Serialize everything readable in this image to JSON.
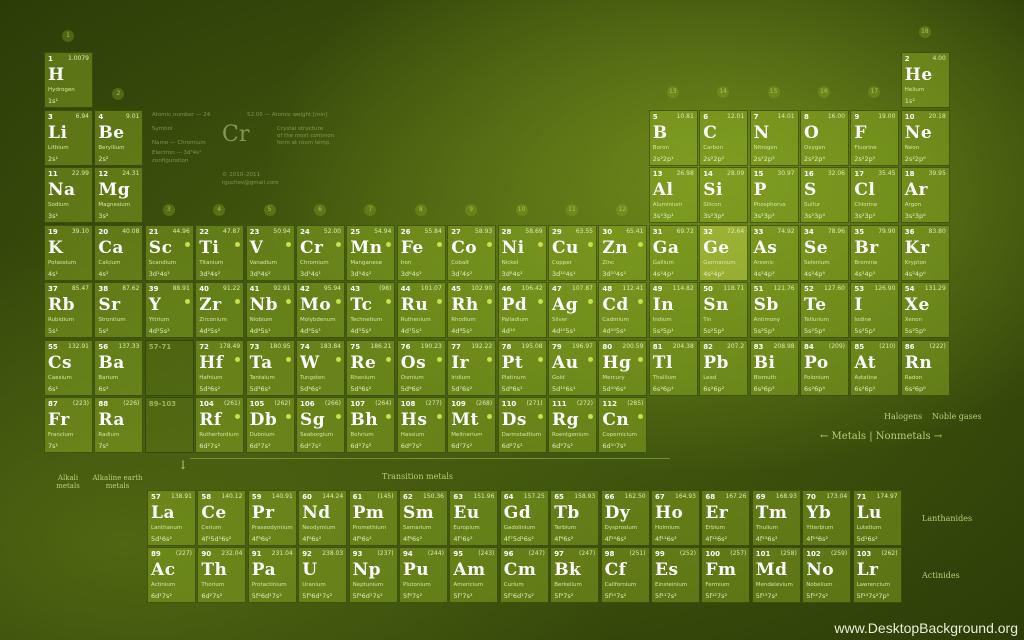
{
  "colors": {
    "accent": "#c8e04a",
    "background": "#3b4f0c"
  },
  "elements": [
    {
      "n": "1",
      "s": "H",
      "m": "1.0079",
      "nm": "Hydrogen",
      "c": "1s¹",
      "r": 1,
      "col": 1
    },
    {
      "n": "2",
      "s": "He",
      "m": "4.00",
      "nm": "Helium",
      "c": "1s²",
      "r": 1,
      "col": 18
    },
    {
      "n": "3",
      "s": "Li",
      "m": "6.94",
      "nm": "Lithium",
      "c": "2s¹",
      "r": 2,
      "col": 1
    },
    {
      "n": "4",
      "s": "Be",
      "m": "9.01",
      "nm": "Beryllium",
      "c": "2s²",
      "r": 2,
      "col": 2
    },
    {
      "n": "5",
      "s": "B",
      "m": "10.81",
      "nm": "Boron",
      "c": "2s²2p¹",
      "r": 2,
      "col": 13
    },
    {
      "n": "6",
      "s": "C",
      "m": "12.01",
      "nm": "Carbon",
      "c": "2s²2p²",
      "r": 2,
      "col": 14
    },
    {
      "n": "7",
      "s": "N",
      "m": "14.01",
      "nm": "Nitrogen",
      "c": "2s²2p³",
      "r": 2,
      "col": 15
    },
    {
      "n": "8",
      "s": "O",
      "m": "16.00",
      "nm": "Oxygen",
      "c": "2s²2p⁴",
      "r": 2,
      "col": 16
    },
    {
      "n": "9",
      "s": "F",
      "m": "19.00",
      "nm": "Fluorine",
      "c": "2s²2p⁵",
      "r": 2,
      "col": 17
    },
    {
      "n": "10",
      "s": "Ne",
      "m": "20.18",
      "nm": "Neon",
      "c": "2s²2p⁶",
      "r": 2,
      "col": 18
    },
    {
      "n": "11",
      "s": "Na",
      "m": "22.99",
      "nm": "Sodium",
      "c": "3s¹",
      "r": 3,
      "col": 1
    },
    {
      "n": "12",
      "s": "Mg",
      "m": "24.31",
      "nm": "Magnesium",
      "c": "3s²",
      "r": 3,
      "col": 2
    },
    {
      "n": "13",
      "s": "Al",
      "m": "26.98",
      "nm": "Aluminium",
      "c": "3s²3p¹",
      "r": 3,
      "col": 13
    },
    {
      "n": "14",
      "s": "Si",
      "m": "28.09",
      "nm": "Silicon",
      "c": "3s²3p²",
      "r": 3,
      "col": 14
    },
    {
      "n": "15",
      "s": "P",
      "m": "30.97",
      "nm": "Phosphorus",
      "c": "3s²3p³",
      "r": 3,
      "col": 15
    },
    {
      "n": "16",
      "s": "S",
      "m": "32.06",
      "nm": "Sulfur",
      "c": "3s²3p⁴",
      "r": 3,
      "col": 16
    },
    {
      "n": "17",
      "s": "Cl",
      "m": "35.45",
      "nm": "Chlorine",
      "c": "3s²3p⁵",
      "r": 3,
      "col": 17
    },
    {
      "n": "18",
      "s": "Ar",
      "m": "39.95",
      "nm": "Argon",
      "c": "3s²3p⁶",
      "r": 3,
      "col": 18
    },
    {
      "n": "19",
      "s": "K",
      "m": "39.10",
      "nm": "Potassium",
      "c": "4s¹",
      "r": 4,
      "col": 1
    },
    {
      "n": "20",
      "s": "Ca",
      "m": "40.08",
      "nm": "Calcium",
      "c": "4s²",
      "r": 4,
      "col": 2
    },
    {
      "n": "21",
      "s": "Sc",
      "m": "44.96",
      "nm": "Scandium",
      "c": "3d¹4s²",
      "r": 4,
      "col": 3
    },
    {
      "n": "22",
      "s": "Ti",
      "m": "47.87",
      "nm": "Titanium",
      "c": "3d²4s²",
      "r": 4,
      "col": 4
    },
    {
      "n": "23",
      "s": "V",
      "m": "50.94",
      "nm": "Vanadium",
      "c": "3d³4s²",
      "r": 4,
      "col": 5
    },
    {
      "n": "24",
      "s": "Cr",
      "m": "52.00",
      "nm": "Chromium",
      "c": "3d⁵4s¹",
      "r": 4,
      "col": 6
    },
    {
      "n": "25",
      "s": "Mn",
      "m": "54.94",
      "nm": "Manganese",
      "c": "3d⁵4s²",
      "r": 4,
      "col": 7
    },
    {
      "n": "26",
      "s": "Fe",
      "m": "55.84",
      "nm": "Iron",
      "c": "3d⁶4s²",
      "r": 4,
      "col": 8
    },
    {
      "n": "27",
      "s": "Co",
      "m": "58.93",
      "nm": "Cobalt",
      "c": "3d⁷4s²",
      "r": 4,
      "col": 9
    },
    {
      "n": "28",
      "s": "Ni",
      "m": "58.69",
      "nm": "Nickel",
      "c": "3d⁸4s²",
      "r": 4,
      "col": 10
    },
    {
      "n": "29",
      "s": "Cu",
      "m": "63.55",
      "nm": "Copper",
      "c": "3d¹⁰4s¹",
      "r": 4,
      "col": 11
    },
    {
      "n": "30",
      "s": "Zn",
      "m": "65.41",
      "nm": "Zinc",
      "c": "3d¹⁰4s²",
      "r": 4,
      "col": 12
    },
    {
      "n": "31",
      "s": "Ga",
      "m": "69.72",
      "nm": "Gallium",
      "c": "4s²4p¹",
      "r": 4,
      "col": 13
    },
    {
      "n": "32",
      "s": "Ge",
      "m": "72.64",
      "nm": "Germanium",
      "c": "4s²4p²",
      "r": 4,
      "col": 14,
      "hl": true
    },
    {
      "n": "33",
      "s": "As",
      "m": "74.92",
      "nm": "Arsenic",
      "c": "4s²4p³",
      "r": 4,
      "col": 15
    },
    {
      "n": "34",
      "s": "Se",
      "m": "78.96",
      "nm": "Selenium",
      "c": "4s²4p⁴",
      "r": 4,
      "col": 16
    },
    {
      "n": "35",
      "s": "Br",
      "m": "79.90",
      "nm": "Bromine",
      "c": "4s²4p⁵",
      "r": 4,
      "col": 17
    },
    {
      "n": "36",
      "s": "Kr",
      "m": "83.80",
      "nm": "Krypton",
      "c": "4s²4p⁶",
      "r": 4,
      "col": 18
    },
    {
      "n": "37",
      "s": "Rb",
      "m": "85.47",
      "nm": "Rubidium",
      "c": "5s¹",
      "r": 5,
      "col": 1
    },
    {
      "n": "38",
      "s": "Sr",
      "m": "87.62",
      "nm": "Strontium",
      "c": "5s²",
      "r": 5,
      "col": 2
    },
    {
      "n": "39",
      "s": "Y",
      "m": "88.91",
      "nm": "Yttrium",
      "c": "4d¹5s²",
      "r": 5,
      "col": 3
    },
    {
      "n": "40",
      "s": "Zr",
      "m": "91.22",
      "nm": "Zirconium",
      "c": "4d²5s²",
      "r": 5,
      "col": 4
    },
    {
      "n": "41",
      "s": "Nb",
      "m": "92.91",
      "nm": "Niobium",
      "c": "4d⁴5s¹",
      "r": 5,
      "col": 5
    },
    {
      "n": "42",
      "s": "Mo",
      "m": "95.94",
      "nm": "Molybdenum",
      "c": "4d⁵5s¹",
      "r": 5,
      "col": 6
    },
    {
      "n": "43",
      "s": "Tc",
      "m": "(98)",
      "nm": "Technetium",
      "c": "4d⁵5s²",
      "r": 5,
      "col": 7
    },
    {
      "n": "44",
      "s": "Ru",
      "m": "101.07",
      "nm": "Ruthenium",
      "c": "4d⁷5s¹",
      "r": 5,
      "col": 8
    },
    {
      "n": "45",
      "s": "Rh",
      "m": "102.90",
      "nm": "Rhodium",
      "c": "4d⁸5s¹",
      "r": 5,
      "col": 9
    },
    {
      "n": "46",
      "s": "Pd",
      "m": "106.42",
      "nm": "Palladium",
      "c": "4d¹⁰",
      "r": 5,
      "col": 10
    },
    {
      "n": "47",
      "s": "Ag",
      "m": "107.87",
      "nm": "Silver",
      "c": "4d¹⁰5s¹",
      "r": 5,
      "col": 11
    },
    {
      "n": "48",
      "s": "Cd",
      "m": "112.41",
      "nm": "Cadmium",
      "c": "4d¹⁰5s²",
      "r": 5,
      "col": 12
    },
    {
      "n": "49",
      "s": "In",
      "m": "114.82",
      "nm": "Indium",
      "c": "5s²5p¹",
      "r": 5,
      "col": 13
    },
    {
      "n": "50",
      "s": "Sn",
      "m": "118.71",
      "nm": "Tin",
      "c": "5s²5p²",
      "r": 5,
      "col": 14
    },
    {
      "n": "51",
      "s": "Sb",
      "m": "121.76",
      "nm": "Antimony",
      "c": "5s²5p³",
      "r": 5,
      "col": 15
    },
    {
      "n": "52",
      "s": "Te",
      "m": "127.60",
      "nm": "Tellurium",
      "c": "5s²5p⁴",
      "r": 5,
      "col": 16
    },
    {
      "n": "53",
      "s": "I",
      "m": "126.90",
      "nm": "Iodine",
      "c": "5s²5p⁵",
      "r": 5,
      "col": 17
    },
    {
      "n": "54",
      "s": "Xe",
      "m": "131.29",
      "nm": "Xenon",
      "c": "5s²5p⁶",
      "r": 5,
      "col": 18
    },
    {
      "n": "55",
      "s": "Cs",
      "m": "132.91",
      "nm": "Caesium",
      "c": "6s¹",
      "r": 6,
      "col": 1
    },
    {
      "n": "56",
      "s": "Ba",
      "m": "137.33",
      "nm": "Barium",
      "c": "6s²",
      "r": 6,
      "col": 2
    },
    {
      "n": "72",
      "s": "Hf",
      "m": "178.49",
      "nm": "Hafnium",
      "c": "5d²6s²",
      "r": 6,
      "col": 4
    },
    {
      "n": "73",
      "s": "Ta",
      "m": "180.95",
      "nm": "Tantalum",
      "c": "5d³6s²",
      "r": 6,
      "col": 5
    },
    {
      "n": "74",
      "s": "W",
      "m": "183.84",
      "nm": "Tungsten",
      "c": "5d⁴6s²",
      "r": 6,
      "col": 6
    },
    {
      "n": "75",
      "s": "Re",
      "m": "186.21",
      "nm": "Rhenium",
      "c": "5d⁵6s²",
      "r": 6,
      "col": 7
    },
    {
      "n": "76",
      "s": "Os",
      "m": "190.23",
      "nm": "Osmium",
      "c": "5d⁶6s²",
      "r": 6,
      "col": 8
    },
    {
      "n": "77",
      "s": "Ir",
      "m": "192.22",
      "nm": "Iridium",
      "c": "5d⁷6s²",
      "r": 6,
      "col": 9
    },
    {
      "n": "78",
      "s": "Pt",
      "m": "195.08",
      "nm": "Platinum",
      "c": "5d⁹6s¹",
      "r": 6,
      "col": 10
    },
    {
      "n": "79",
      "s": "Au",
      "m": "196.97",
      "nm": "Gold",
      "c": "5d¹⁰6s¹",
      "r": 6,
      "col": 11
    },
    {
      "n": "80",
      "s": "Hg",
      "m": "200.59",
      "nm": "Mercury",
      "c": "5d¹⁰6s²",
      "r": 6,
      "col": 12
    },
    {
      "n": "81",
      "s": "Tl",
      "m": "204.38",
      "nm": "Thallium",
      "c": "6s²6p¹",
      "r": 6,
      "col": 13
    },
    {
      "n": "82",
      "s": "Pb",
      "m": "207.2",
      "nm": "Lead",
      "c": "6s²6p²",
      "r": 6,
      "col": 14
    },
    {
      "n": "83",
      "s": "Bi",
      "m": "208.98",
      "nm": "Bismuth",
      "c": "6s²6p³",
      "r": 6,
      "col": 15
    },
    {
      "n": "84",
      "s": "Po",
      "m": "(209)",
      "nm": "Polonium",
      "c": "6s²6p⁴",
      "r": 6,
      "col": 16
    },
    {
      "n": "85",
      "s": "At",
      "m": "(210)",
      "nm": "Astatine",
      "c": "6s²6p⁵",
      "r": 6,
      "col": 17
    },
    {
      "n": "86",
      "s": "Rn",
      "m": "(222)",
      "nm": "Radon",
      "c": "6s²6p⁶",
      "r": 6,
      "col": 18
    },
    {
      "n": "87",
      "s": "Fr",
      "m": "(223)",
      "nm": "Francium",
      "c": "7s¹",
      "r": 7,
      "col": 1
    },
    {
      "n": "88",
      "s": "Ra",
      "m": "(226)",
      "nm": "Radium",
      "c": "7s²",
      "r": 7,
      "col": 2
    },
    {
      "n": "104",
      "s": "Rf",
      "m": "(261)",
      "nm": "Rutherfordium",
      "c": "6d²7s²",
      "r": 7,
      "col": 4
    },
    {
      "n": "105",
      "s": "Db",
      "m": "(262)",
      "nm": "Dubnium",
      "c": "6d³7s²",
      "r": 7,
      "col": 5
    },
    {
      "n": "106",
      "s": "Sg",
      "m": "(266)",
      "nm": "Seaborgium",
      "c": "6d⁴7s²",
      "r": 7,
      "col": 6
    },
    {
      "n": "107",
      "s": "Bh",
      "m": "(264)",
      "nm": "Bohrium",
      "c": "6d⁵7s²",
      "r": 7,
      "col": 7
    },
    {
      "n": "108",
      "s": "Hs",
      "m": "(277)",
      "nm": "Hassium",
      "c": "6d⁶7s²",
      "r": 7,
      "col": 8
    },
    {
      "n": "109",
      "s": "Mt",
      "m": "(268)",
      "nm": "Meitnerium",
      "c": "6d⁷7s²",
      "r": 7,
      "col": 9
    },
    {
      "n": "110",
      "s": "Ds",
      "m": "(271)",
      "nm": "Darmstadtium",
      "c": "6d⁸7s²",
      "r": 7,
      "col": 10
    },
    {
      "n": "111",
      "s": "Rg",
      "m": "(272)",
      "nm": "Roentgenium",
      "c": "6d⁹7s²",
      "r": 7,
      "col": 11
    },
    {
      "n": "112",
      "s": "Cn",
      "m": "(285)",
      "nm": "Copernicium",
      "c": "6d¹⁰7s²",
      "r": 7,
      "col": 12
    }
  ],
  "lanthanides": [
    {
      "n": "57",
      "s": "La",
      "m": "138.91",
      "nm": "Lanthanum",
      "c": "5d¹6s²"
    },
    {
      "n": "58",
      "s": "Ce",
      "m": "140.12",
      "nm": "Cerium",
      "c": "4f¹5d¹6s²"
    },
    {
      "n": "59",
      "s": "Pr",
      "m": "140.91",
      "nm": "Praseodymium",
      "c": "4f³6s²"
    },
    {
      "n": "60",
      "s": "Nd",
      "m": "144.24",
      "nm": "Neodymium",
      "c": "4f⁴6s²"
    },
    {
      "n": "61",
      "s": "Pm",
      "m": "(145)",
      "nm": "Promethium",
      "c": "4f⁵6s²"
    },
    {
      "n": "62",
      "s": "Sm",
      "m": "150.36",
      "nm": "Samarium",
      "c": "4f⁶6s²"
    },
    {
      "n": "63",
      "s": "Eu",
      "m": "151.96",
      "nm": "Europium",
      "c": "4f⁷6s²"
    },
    {
      "n": "64",
      "s": "Gd",
      "m": "157.25",
      "nm": "Gadolinium",
      "c": "4f⁷5d¹6s²"
    },
    {
      "n": "65",
      "s": "Tb",
      "m": "158.93",
      "nm": "Terbium",
      "c": "4f⁹6s²"
    },
    {
      "n": "66",
      "s": "Dy",
      "m": "162.50",
      "nm": "Dysprosium",
      "c": "4f¹⁰6s²"
    },
    {
      "n": "67",
      "s": "Ho",
      "m": "164.93",
      "nm": "Holmium",
      "c": "4f¹¹6s²"
    },
    {
      "n": "68",
      "s": "Er",
      "m": "167.26",
      "nm": "Erbium",
      "c": "4f¹²6s²"
    },
    {
      "n": "69",
      "s": "Tm",
      "m": "168.93",
      "nm": "Thulium",
      "c": "4f¹³6s²"
    },
    {
      "n": "70",
      "s": "Yb",
      "m": "173.04",
      "nm": "Ytterbium",
      "c": "4f¹⁴6s²"
    },
    {
      "n": "71",
      "s": "Lu",
      "m": "174.97",
      "nm": "Lutetium",
      "c": "5d¹6s²"
    }
  ],
  "actinides": [
    {
      "n": "89",
      "s": "Ac",
      "m": "(227)",
      "nm": "Actinium",
      "c": "6d¹7s²"
    },
    {
      "n": "90",
      "s": "Th",
      "m": "232.04",
      "nm": "Thorium",
      "c": "6d²7s²"
    },
    {
      "n": "91",
      "s": "Pa",
      "m": "231.04",
      "nm": "Protactinium",
      "c": "5f²6d¹7s²"
    },
    {
      "n": "92",
      "s": "U",
      "m": "238.03",
      "nm": "Uranium",
      "c": "5f³6d¹7s²"
    },
    {
      "n": "93",
      "s": "Np",
      "m": "(237)",
      "nm": "Neptunium",
      "c": "5f⁴6d¹7s²"
    },
    {
      "n": "94",
      "s": "Pu",
      "m": "(244)",
      "nm": "Plutonium",
      "c": "5f⁶7s²"
    },
    {
      "n": "95",
      "s": "Am",
      "m": "(243)",
      "nm": "Americium",
      "c": "5f⁷7s²"
    },
    {
      "n": "96",
      "s": "Cm",
      "m": "(247)",
      "nm": "Curium",
      "c": "5f⁷6d¹7s²"
    },
    {
      "n": "97",
      "s": "Bk",
      "m": "(247)",
      "nm": "Berkelium",
      "c": "5f⁹7s²"
    },
    {
      "n": "98",
      "s": "Cf",
      "m": "(251)",
      "nm": "Californium",
      "c": "5f¹⁰7s²"
    },
    {
      "n": "99",
      "s": "Es",
      "m": "(252)",
      "nm": "Einsteinium",
      "c": "5f¹¹7s²"
    },
    {
      "n": "100",
      "s": "Fm",
      "m": "(257)",
      "nm": "Fermium",
      "c": "5f¹²7s²"
    },
    {
      "n": "101",
      "s": "Md",
      "m": "(258)",
      "nm": "Mendelevium",
      "c": "5f¹³7s²"
    },
    {
      "n": "102",
      "s": "No",
      "m": "(259)",
      "nm": "Nobelium",
      "c": "5f¹⁴7s²"
    },
    {
      "n": "103",
      "s": "Lr",
      "m": "(262)",
      "nm": "Lawrencium",
      "c": "5f¹⁴7s²7p¹"
    }
  ],
  "groups": [
    "1",
    "2",
    "3",
    "4",
    "5",
    "6",
    "7",
    "8",
    "9",
    "10",
    "11",
    "12",
    "13",
    "14",
    "15",
    "16",
    "17",
    "18"
  ],
  "placeholders": {
    "lanthanide_slot": "57-71",
    "actinide_slot": "89-103"
  },
  "labels": {
    "alkali": "Alkali metals",
    "alkaline": "Alkaline earth metals",
    "transition": "Transition metals",
    "halogens": "Halogens",
    "noble": "Noble gases",
    "metals": "← Metals | Nonmetals →",
    "lanthanides": "Lanthanides",
    "actinides": "Actinides"
  },
  "legend": {
    "symbol": "Cr",
    "atomic_number": "Atomic number — 24",
    "atomic_weight": "52.00 — Atomic weight [min]",
    "symbol_label": "Symbol",
    "name_label": "Name — Chromium",
    "config_label": "Electron — 3d⁵4s¹",
    "config_sub": "configuration",
    "crystal": "Crystal structure",
    "crystal_sub": "of the most common",
    "crystal_sub2": "form at room temp.",
    "copyright": "© 2010–2011",
    "email": "rguchev@gmail.com"
  },
  "watermark": "www.DesktopBackground.org"
}
